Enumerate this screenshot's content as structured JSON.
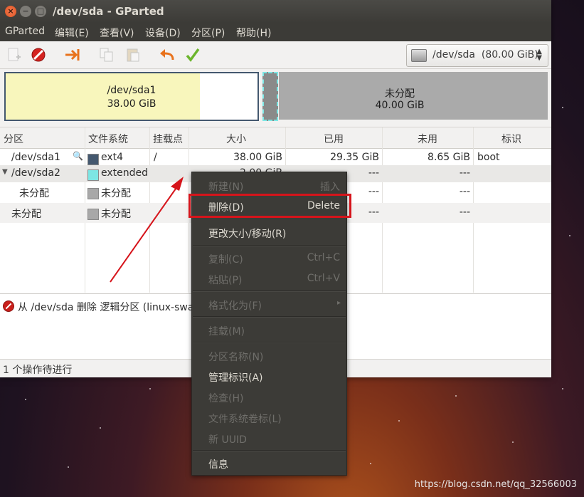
{
  "window": {
    "title": "/dev/sda - GParted",
    "buttons": {
      "close": "×",
      "minimize": "−",
      "maximize": "□"
    }
  },
  "menubar": [
    "GParted",
    "编辑(E)",
    "查看(V)",
    "设备(D)",
    "分区(P)",
    "帮助(H)"
  ],
  "toolbar": {
    "icons": [
      "new-partition-icon",
      "delete-icon",
      "resize-move-icon",
      "copy-icon",
      "paste-icon",
      "undo-icon",
      "apply-icon"
    ],
    "device_selector": "/dev/sda  (80.00 GiB)"
  },
  "diskmap": {
    "p1_name": "/dev/sda1",
    "p1_size": "38.00 GiB",
    "p1_used_fraction": 0.77,
    "unalloc_name": "未分配",
    "unalloc_size": "40.00 GiB"
  },
  "table": {
    "headers": [
      "分区",
      "文件系统",
      "挂载点",
      "大小",
      "已用",
      "未用",
      "标识"
    ],
    "rows": [
      {
        "partition": "/dev/sda1",
        "fs": "ext4",
        "fs_color": "#44586f",
        "mount": "/",
        "size": "38.00 GiB",
        "used": "29.35 GiB",
        "unused": "8.65 GiB",
        "flags": "boot"
      },
      {
        "partition": "/dev/sda2",
        "fs": "extended",
        "fs_color": "#7de6e4",
        "mount": "",
        "size": "2.00 GiB",
        "used": "---",
        "unused": "---",
        "flags": ""
      },
      {
        "partition": "未分配",
        "fs": "未分配",
        "fs_color": "#a8a8a8",
        "mount": "",
        "size": "",
        "used": "---",
        "unused": "---",
        "flags": ""
      },
      {
        "partition": "未分配",
        "fs": "未分配",
        "fs_color": "#a8a8a8",
        "mount": "",
        "size": "",
        "used": "---",
        "unused": "---",
        "flags": ""
      }
    ]
  },
  "operations": {
    "pending": "从 /dev/sda 删除 逻辑分区 (linux-swa",
    "status": "1 个操作待进行"
  },
  "context_menu": {
    "items": [
      {
        "label": "新建(N)",
        "shortcut": "插入",
        "enabled": false
      },
      {
        "label": "删除(D)",
        "shortcut": "Delete",
        "enabled": true
      },
      {
        "label": "更改大小/移动(R)",
        "shortcut": "",
        "enabled": true
      },
      {
        "label": "复制(C)",
        "shortcut": "Ctrl+C",
        "enabled": false
      },
      {
        "label": "粘贴(P)",
        "shortcut": "Ctrl+V",
        "enabled": false
      },
      {
        "label": "格式化为(F)",
        "shortcut": "",
        "enabled": false
      },
      {
        "label": "挂载(M)",
        "shortcut": "",
        "enabled": false
      },
      {
        "label": "分区名称(N)",
        "shortcut": "",
        "enabled": false
      },
      {
        "label": "管理标识(A)",
        "shortcut": "",
        "enabled": true
      },
      {
        "label": "检查(H)",
        "shortcut": "",
        "enabled": false
      },
      {
        "label": "文件系统卷标(L)",
        "shortcut": "",
        "enabled": false
      },
      {
        "label": "新 UUID",
        "shortcut": "",
        "enabled": false
      },
      {
        "label": "信息",
        "shortcut": "",
        "enabled": true
      }
    ]
  },
  "watermark": "https://blog.csdn.net/qq_32566003",
  "colors": {
    "highlight": "#d6141b",
    "arrow": "#d6141b",
    "ext4": "#44586f",
    "extended": "#7de6e4",
    "unallocated": "#aaaaaa"
  }
}
